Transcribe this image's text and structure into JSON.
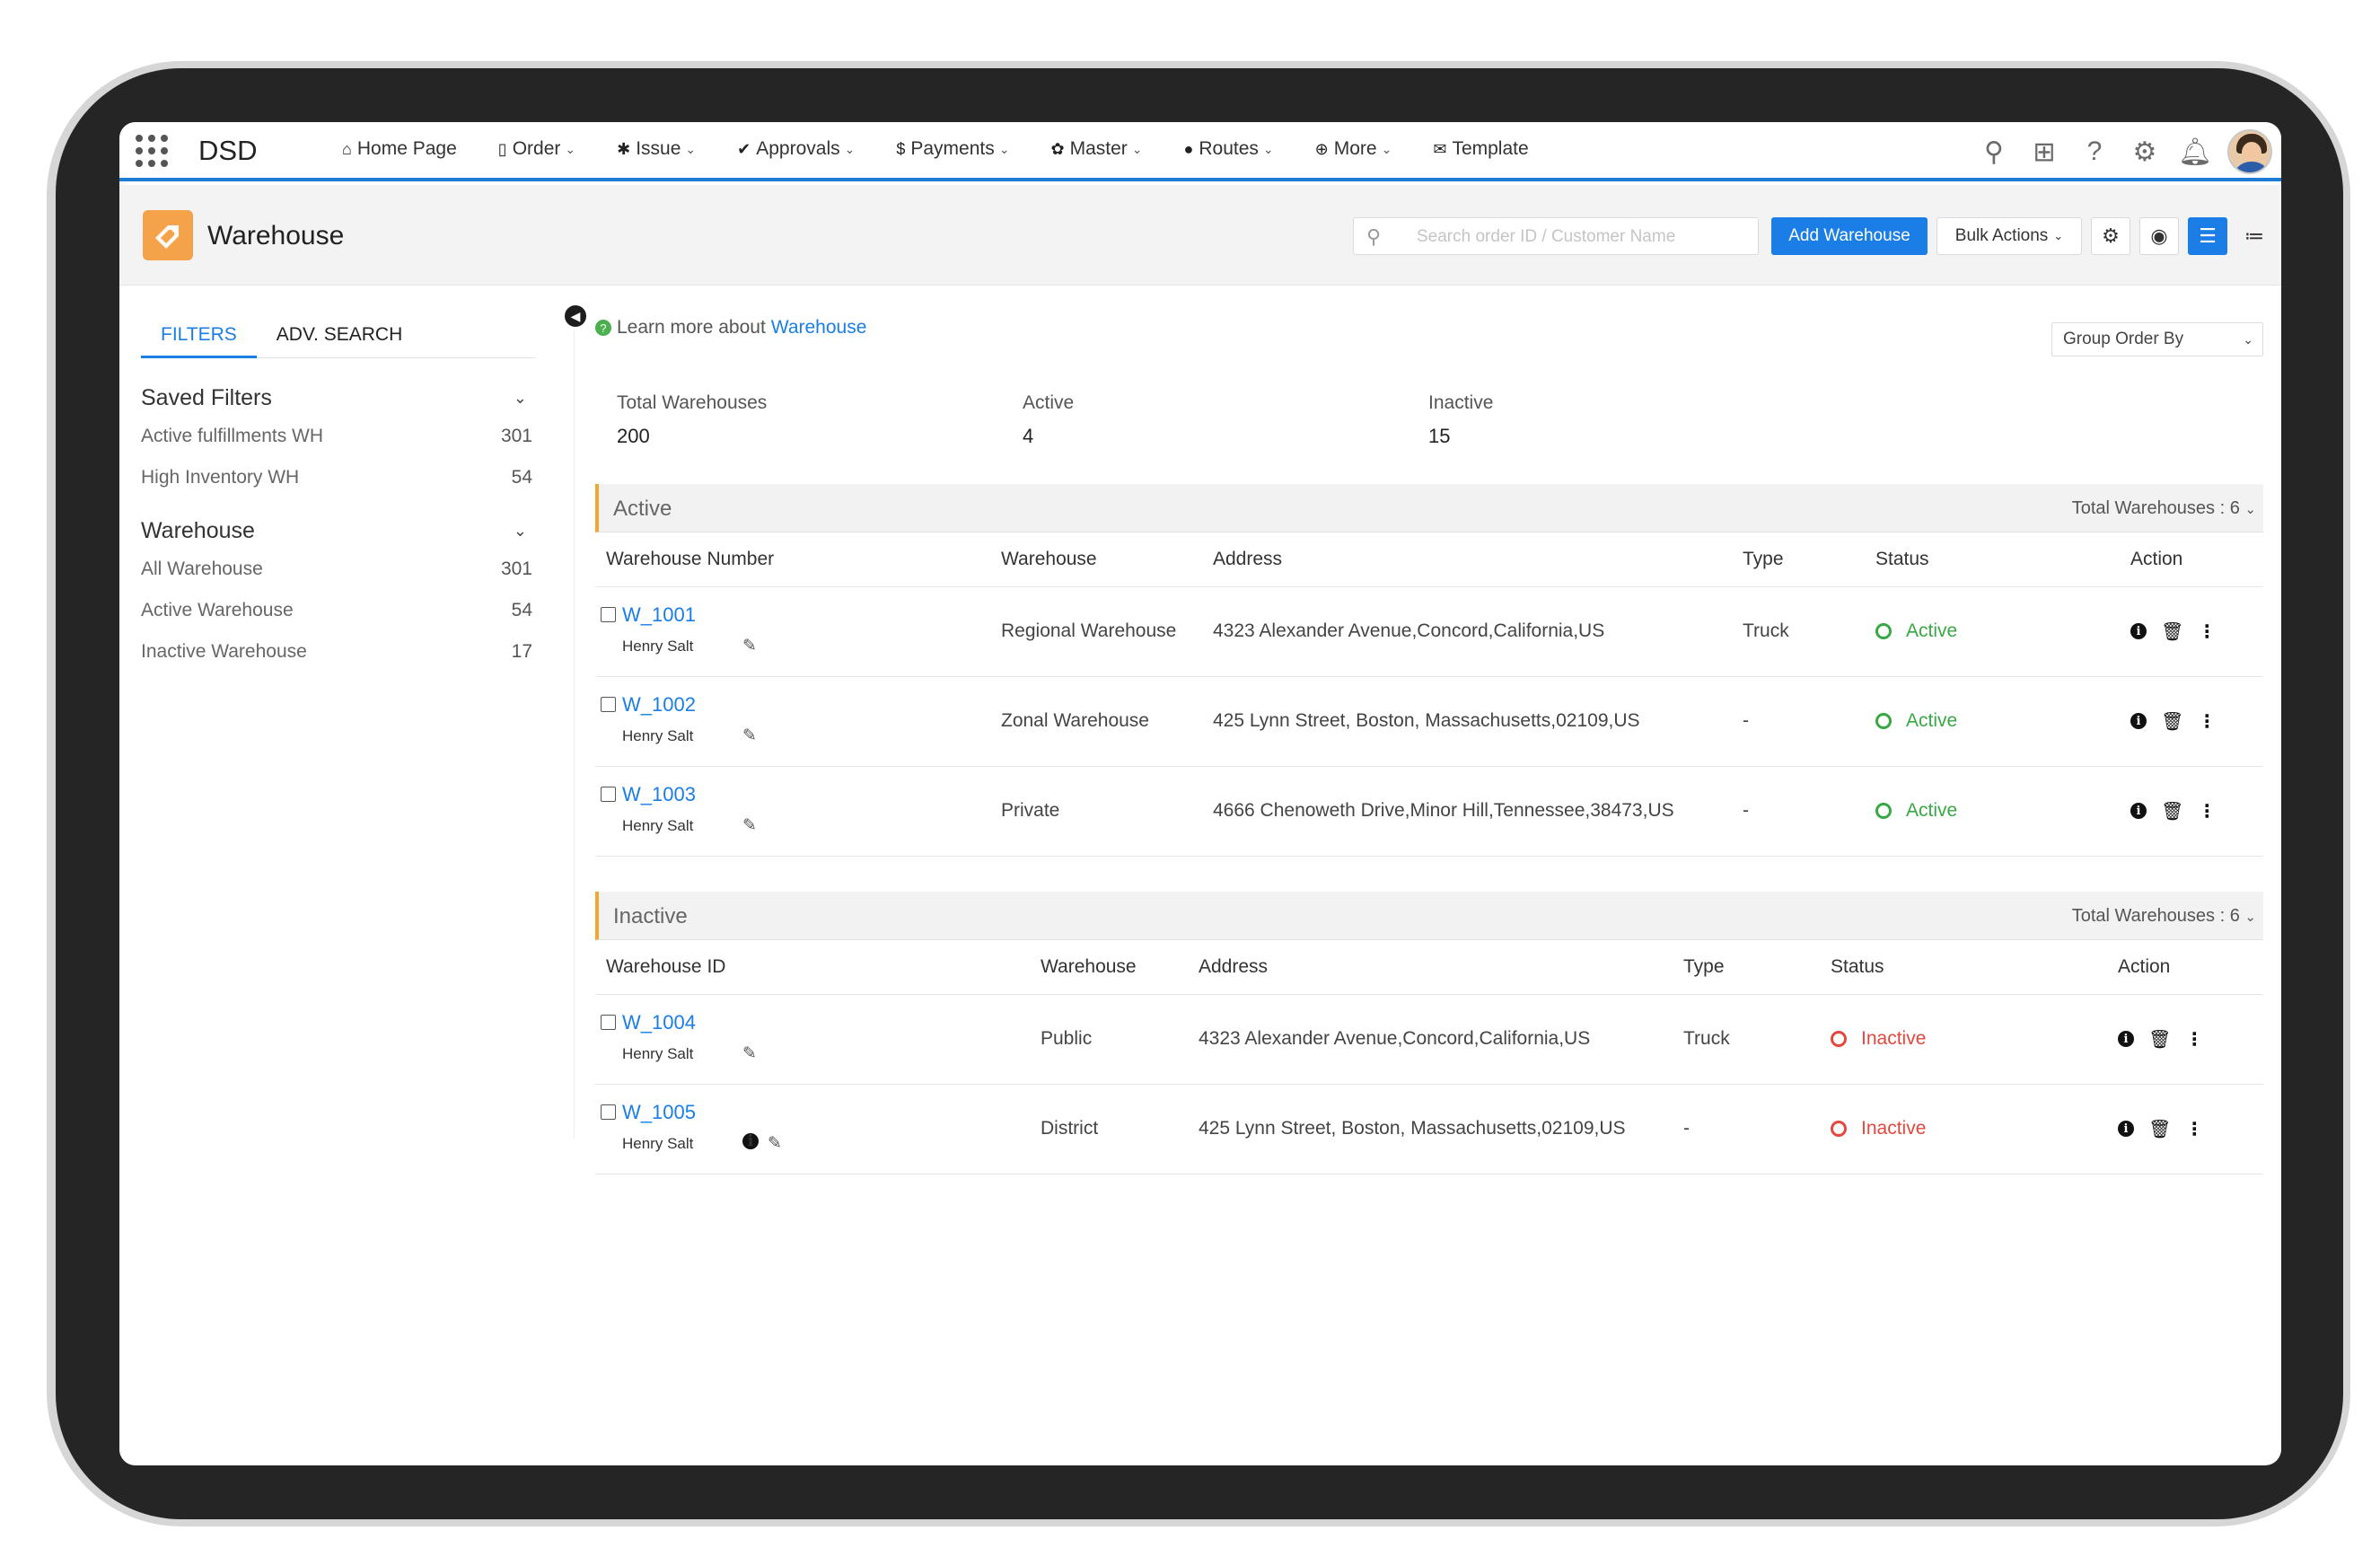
{
  "app": {
    "name": "DSD"
  },
  "nav": [
    {
      "label": "Home Page",
      "icon": "home-icon",
      "glyph": "⌂",
      "caret": false
    },
    {
      "label": "Order",
      "icon": "document-icon",
      "glyph": "▯",
      "caret": true
    },
    {
      "label": "Issue",
      "icon": "bug-icon",
      "glyph": "✱",
      "caret": true
    },
    {
      "label": "Approvals",
      "icon": "check-icon",
      "glyph": "✔",
      "caret": true
    },
    {
      "label": "Payments",
      "icon": "dollar-icon",
      "glyph": "$",
      "caret": true
    },
    {
      "label": "Master",
      "icon": "gear-icon",
      "glyph": "✿",
      "caret": true
    },
    {
      "label": "Routes",
      "icon": "map-pin-icon",
      "glyph": "●",
      "caret": true
    },
    {
      "label": "More",
      "icon": "plus-circle-icon",
      "glyph": "⊕",
      "caret": true
    },
    {
      "label": "Template",
      "icon": "envelope-icon",
      "glyph": "✉",
      "caret": false
    }
  ],
  "page": {
    "title": "Warehouse",
    "search_placeholder": "Search order ID / Customer Name",
    "add_button": "Add Warehouse",
    "bulk_button": "Bulk Actions"
  },
  "sidebar": {
    "tabs": [
      "FILTERS",
      "ADV. SEARCH"
    ],
    "saved_filters": {
      "title": "Saved Filters",
      "items": [
        {
          "label": "Active fulfillments WH",
          "count": "301"
        },
        {
          "label": "High Inventory WH",
          "count": "54"
        }
      ]
    },
    "warehouse": {
      "title": "Warehouse",
      "items": [
        {
          "label": "All Warehouse",
          "count": "301"
        },
        {
          "label": "Active Warehouse",
          "count": "54"
        },
        {
          "label": "Inactive Warehouse",
          "count": "17"
        }
      ]
    }
  },
  "main": {
    "learn_prefix": "Learn more about",
    "learn_link": "Warehouse",
    "group_select": "Group Order By",
    "stats": [
      {
        "label": "Total Warehouses",
        "value": "200"
      },
      {
        "label": "Active",
        "value": "4"
      },
      {
        "label": "Inactive",
        "value": "15"
      }
    ]
  },
  "active_group": {
    "name": "Active",
    "total": "Total Warehouses : 6",
    "headers": [
      "Warehouse Number",
      "Warehouse",
      "Address",
      "Type",
      "Status",
      "Action"
    ],
    "rows": [
      {
        "id": "W_1001",
        "owner": "Henry Salt",
        "warehouse": "Regional Warehouse",
        "address": "4323 Alexander Avenue,Concord,California,US",
        "type": "Truck",
        "status": "Active"
      },
      {
        "id": "W_1002",
        "owner": "Henry Salt",
        "warehouse": "Zonal Warehouse",
        "address": "425 Lynn Street, Boston, Massachusetts,02109,US",
        "type": "-",
        "status": "Active"
      },
      {
        "id": "W_1003",
        "owner": "Henry Salt",
        "warehouse": "Private",
        "address": "4666 Chenoweth Drive,Minor Hill,Tennessee,38473,US",
        "type": "-",
        "status": "Active"
      }
    ]
  },
  "inactive_group": {
    "name": "Inactive",
    "total": "Total Warehouses : 6",
    "headers": [
      "Warehouse ID",
      "Warehouse",
      "Address",
      "Type",
      "Status",
      "Action"
    ],
    "rows": [
      {
        "id": "W_1004",
        "owner": "Henry Salt",
        "warehouse": "Public",
        "address": "4323 Alexander Avenue,Concord,California,US",
        "type": "Truck",
        "status": "Inactive"
      },
      {
        "id": "W_1005",
        "owner": "Henry Salt",
        "warehouse": "District",
        "address": "425 Lynn Street, Boston, Massachusetts,02109,US",
        "type": "-",
        "status": "Inactive"
      }
    ]
  },
  "colors": {
    "accent": "#1a7ee6",
    "active": "#38a845",
    "inactive": "#e2483d",
    "group_marker": "#f0a830",
    "page_icon": "#f5a34a"
  }
}
